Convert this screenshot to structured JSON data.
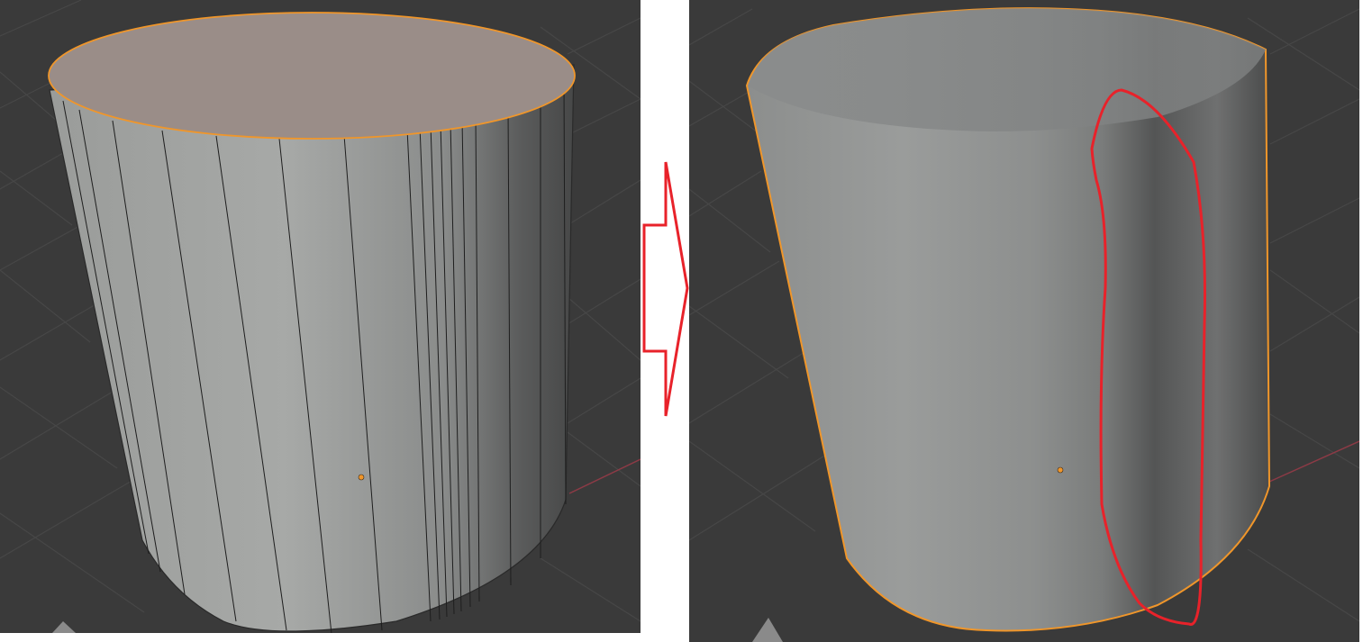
{
  "screens": [
    {
      "name": "before",
      "shading": "flat",
      "selection": "top-face"
    },
    {
      "name": "after",
      "shading": "smooth",
      "selection": "object-outline"
    }
  ],
  "colors": {
    "viewport_bg": "#3a3a3a",
    "grid_line": "#484848",
    "x_axis": "#8c3a46",
    "mesh_light": "#a4a6a4",
    "mesh_dark": "#4e4f4f",
    "selected_face": "#9a8d88",
    "selection_outline": "#f0962a",
    "annotation": "#e8222a",
    "origin_dot": "#f0962a"
  },
  "annotation": {
    "kind": "freehand-red-loop",
    "target": "shading-artifact-band"
  },
  "transition": {
    "kind": "red-outline-arrow"
  }
}
